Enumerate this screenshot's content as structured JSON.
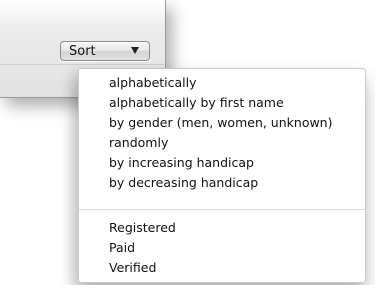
{
  "toolbar": {
    "sort_label": "Sort",
    "sort_icon": "chevron-down-icon"
  },
  "sort_menu": {
    "options": [
      "alphabetically",
      "alphabetically by first name",
      "by gender (men, women, unknown)",
      "randomly",
      "by increasing handicap",
      "by decreasing handicap"
    ],
    "filters": [
      "Registered",
      "Paid",
      "Verified"
    ]
  }
}
